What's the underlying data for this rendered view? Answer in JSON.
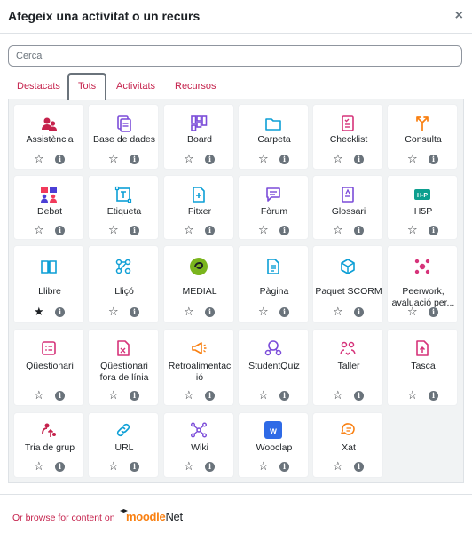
{
  "dialog": {
    "title": "Afegeix una activitat o un recurs",
    "close_symbol": "×"
  },
  "search": {
    "placeholder": "Cerca"
  },
  "tabs": [
    {
      "label": "Destacats",
      "active": false
    },
    {
      "label": "Tots",
      "active": true
    },
    {
      "label": "Activitats",
      "active": false
    },
    {
      "label": "Recursos",
      "active": false
    }
  ],
  "modules": [
    {
      "label": "Assistència",
      "icon": "attendance-icon",
      "color": "#c5224c",
      "favourite": false
    },
    {
      "label": "Base de dades",
      "icon": "database-icon",
      "color": "#7b4cd9",
      "favourite": false
    },
    {
      "label": "Board",
      "icon": "board-icon",
      "color": "#7b4cd9",
      "favourite": false
    },
    {
      "label": "Carpeta",
      "icon": "folder-icon",
      "color": "#0d9fd6",
      "favourite": false
    },
    {
      "label": "Checklist",
      "icon": "checklist-icon",
      "color": "#d6337a",
      "favourite": false
    },
    {
      "label": "Consulta",
      "icon": "choice-icon",
      "color": "#f98012",
      "favourite": false
    },
    {
      "label": "Debat",
      "icon": "debate-icon",
      "color": "#4b3fd6",
      "favourite": false
    },
    {
      "label": "Etiqueta",
      "icon": "label-icon",
      "color": "#0d9fd6",
      "favourite": false
    },
    {
      "label": "Fitxer",
      "icon": "file-icon",
      "color": "#0d9fd6",
      "favourite": false
    },
    {
      "label": "Fòrum",
      "icon": "forum-icon",
      "color": "#7b4cd9",
      "favourite": false
    },
    {
      "label": "Glossari",
      "icon": "glossary-icon",
      "color": "#7b4cd9",
      "favourite": false
    },
    {
      "label": "H5P",
      "icon": "h5p-icon",
      "color": "#0d9f8f",
      "favourite": false
    },
    {
      "label": "Llibre",
      "icon": "book-icon",
      "color": "#0d9fd6",
      "favourite": true
    },
    {
      "label": "Lliçó",
      "icon": "lesson-icon",
      "color": "#0d9fd6",
      "favourite": false
    },
    {
      "label": "MEDIAL",
      "icon": "medial-icon",
      "color": "#7ab51d",
      "favourite": false
    },
    {
      "label": "Pàgina",
      "icon": "page-icon",
      "color": "#0d9fd6",
      "favourite": false
    },
    {
      "label": "Paquet SCORM",
      "icon": "scorm-icon",
      "color": "#0d9fd6",
      "favourite": false
    },
    {
      "label": "Peerwork,\navaluació per...",
      "icon": "peerwork-icon",
      "color": "#d6337a",
      "favourite": false
    },
    {
      "label": "Qüestionari",
      "icon": "quiz-icon",
      "color": "#d6337a",
      "favourite": false
    },
    {
      "label": "Qüestionari\nfora de línia",
      "icon": "offline-quiz-icon",
      "color": "#d6337a",
      "favourite": false
    },
    {
      "label": "Retroalimentac\nió",
      "icon": "feedback-icon",
      "color": "#f98012",
      "favourite": false
    },
    {
      "label": "StudentQuiz",
      "icon": "studentquiz-icon",
      "color": "#7b4cd9",
      "favourite": false
    },
    {
      "label": "Taller",
      "icon": "workshop-icon",
      "color": "#d6337a",
      "favourite": false
    },
    {
      "label": "Tasca",
      "icon": "assignment-icon",
      "color": "#d6337a",
      "favourite": false
    },
    {
      "label": "Tria de grup",
      "icon": "group-choice-icon",
      "color": "#c5224c",
      "favourite": false
    },
    {
      "label": "URL",
      "icon": "url-icon",
      "color": "#0d9fd6",
      "favourite": false
    },
    {
      "label": "Wiki",
      "icon": "wiki-icon",
      "color": "#7b4cd9",
      "favourite": false
    },
    {
      "label": "Wooclap",
      "icon": "wooclap-icon",
      "color": "#2e6ae6",
      "favourite": false
    },
    {
      "label": "Xat",
      "icon": "chat-icon",
      "color": "#f98012",
      "favourite": false
    }
  ],
  "footer": {
    "browse_text": "Or browse for content on",
    "brand_moodle": "moodle",
    "brand_net": "Net"
  }
}
